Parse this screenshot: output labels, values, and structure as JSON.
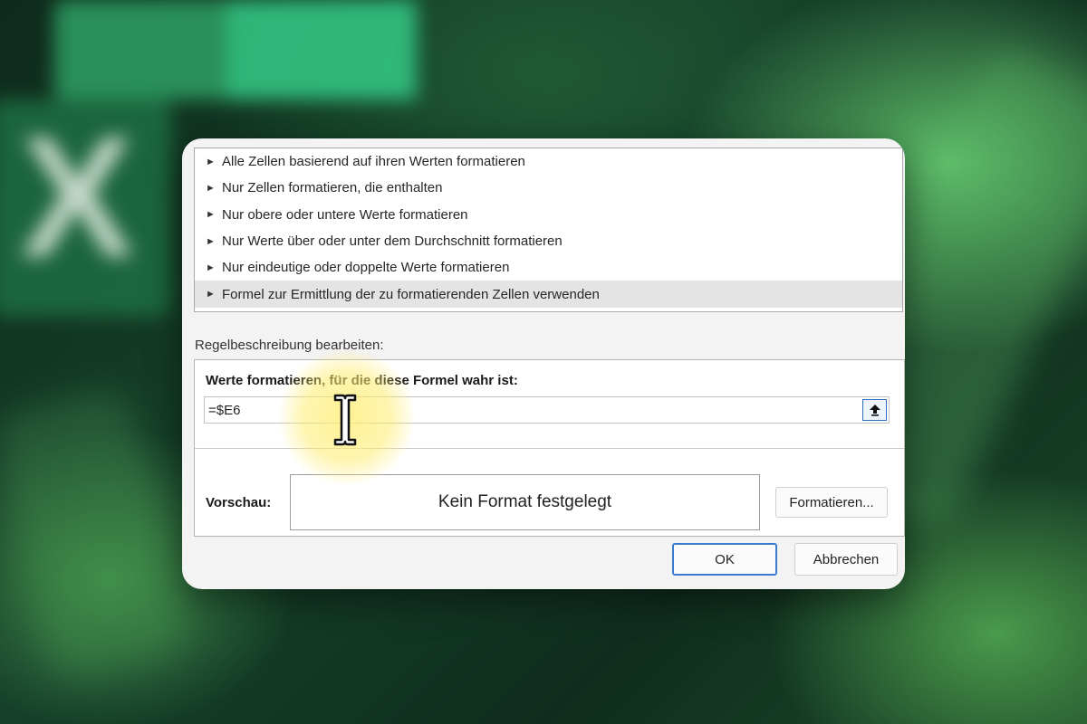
{
  "dialog": {
    "rule_type_list": [
      {
        "label": "Alle Zellen basierend auf ihren Werten formatieren",
        "selected": false
      },
      {
        "label": "Nur Zellen formatieren, die enthalten",
        "selected": false
      },
      {
        "label": "Nur obere oder untere Werte formatieren",
        "selected": false
      },
      {
        "label": "Nur Werte über oder unter dem Durchschnitt formatieren",
        "selected": false
      },
      {
        "label": "Nur eindeutige oder doppelte Werte formatieren",
        "selected": false
      },
      {
        "label": "Formel zur Ermittlung der zu formatierenden Zellen verwenden",
        "selected": true
      }
    ],
    "description_label": "Regelbeschreibung bearbeiten:",
    "formula_heading": "Werte formatieren, für die diese Formel wahr ist:",
    "formula_value": "=$E6",
    "preview_label": "Vorschau:",
    "preview_text": "Kein Format festgelegt",
    "format_button": "Formatieren...",
    "ok_button": "OK",
    "cancel_button": "Abbrechen"
  },
  "icons": {
    "list_bullet": "arrow-right-icon",
    "collapse_button": "arrow-up-icon",
    "cursor": "text-cursor-icon"
  },
  "colors": {
    "accent": "#3b7bcf",
    "selection": "#e4e4e4",
    "highlight": "#ffec6e"
  }
}
